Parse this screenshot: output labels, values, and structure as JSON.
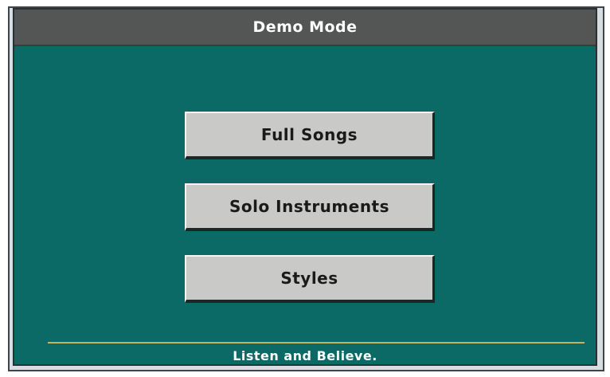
{
  "window": {
    "title": "Demo Mode"
  },
  "menu": {
    "items": [
      {
        "label": "Full Songs"
      },
      {
        "label": "Solo Instruments"
      },
      {
        "label": "Styles"
      }
    ]
  },
  "footer": {
    "text": "Listen and Believe."
  },
  "colors": {
    "background": "#0b6a66",
    "title_bar": "#545656",
    "button": "#c9c9c7",
    "divider": "#c8b25a"
  }
}
